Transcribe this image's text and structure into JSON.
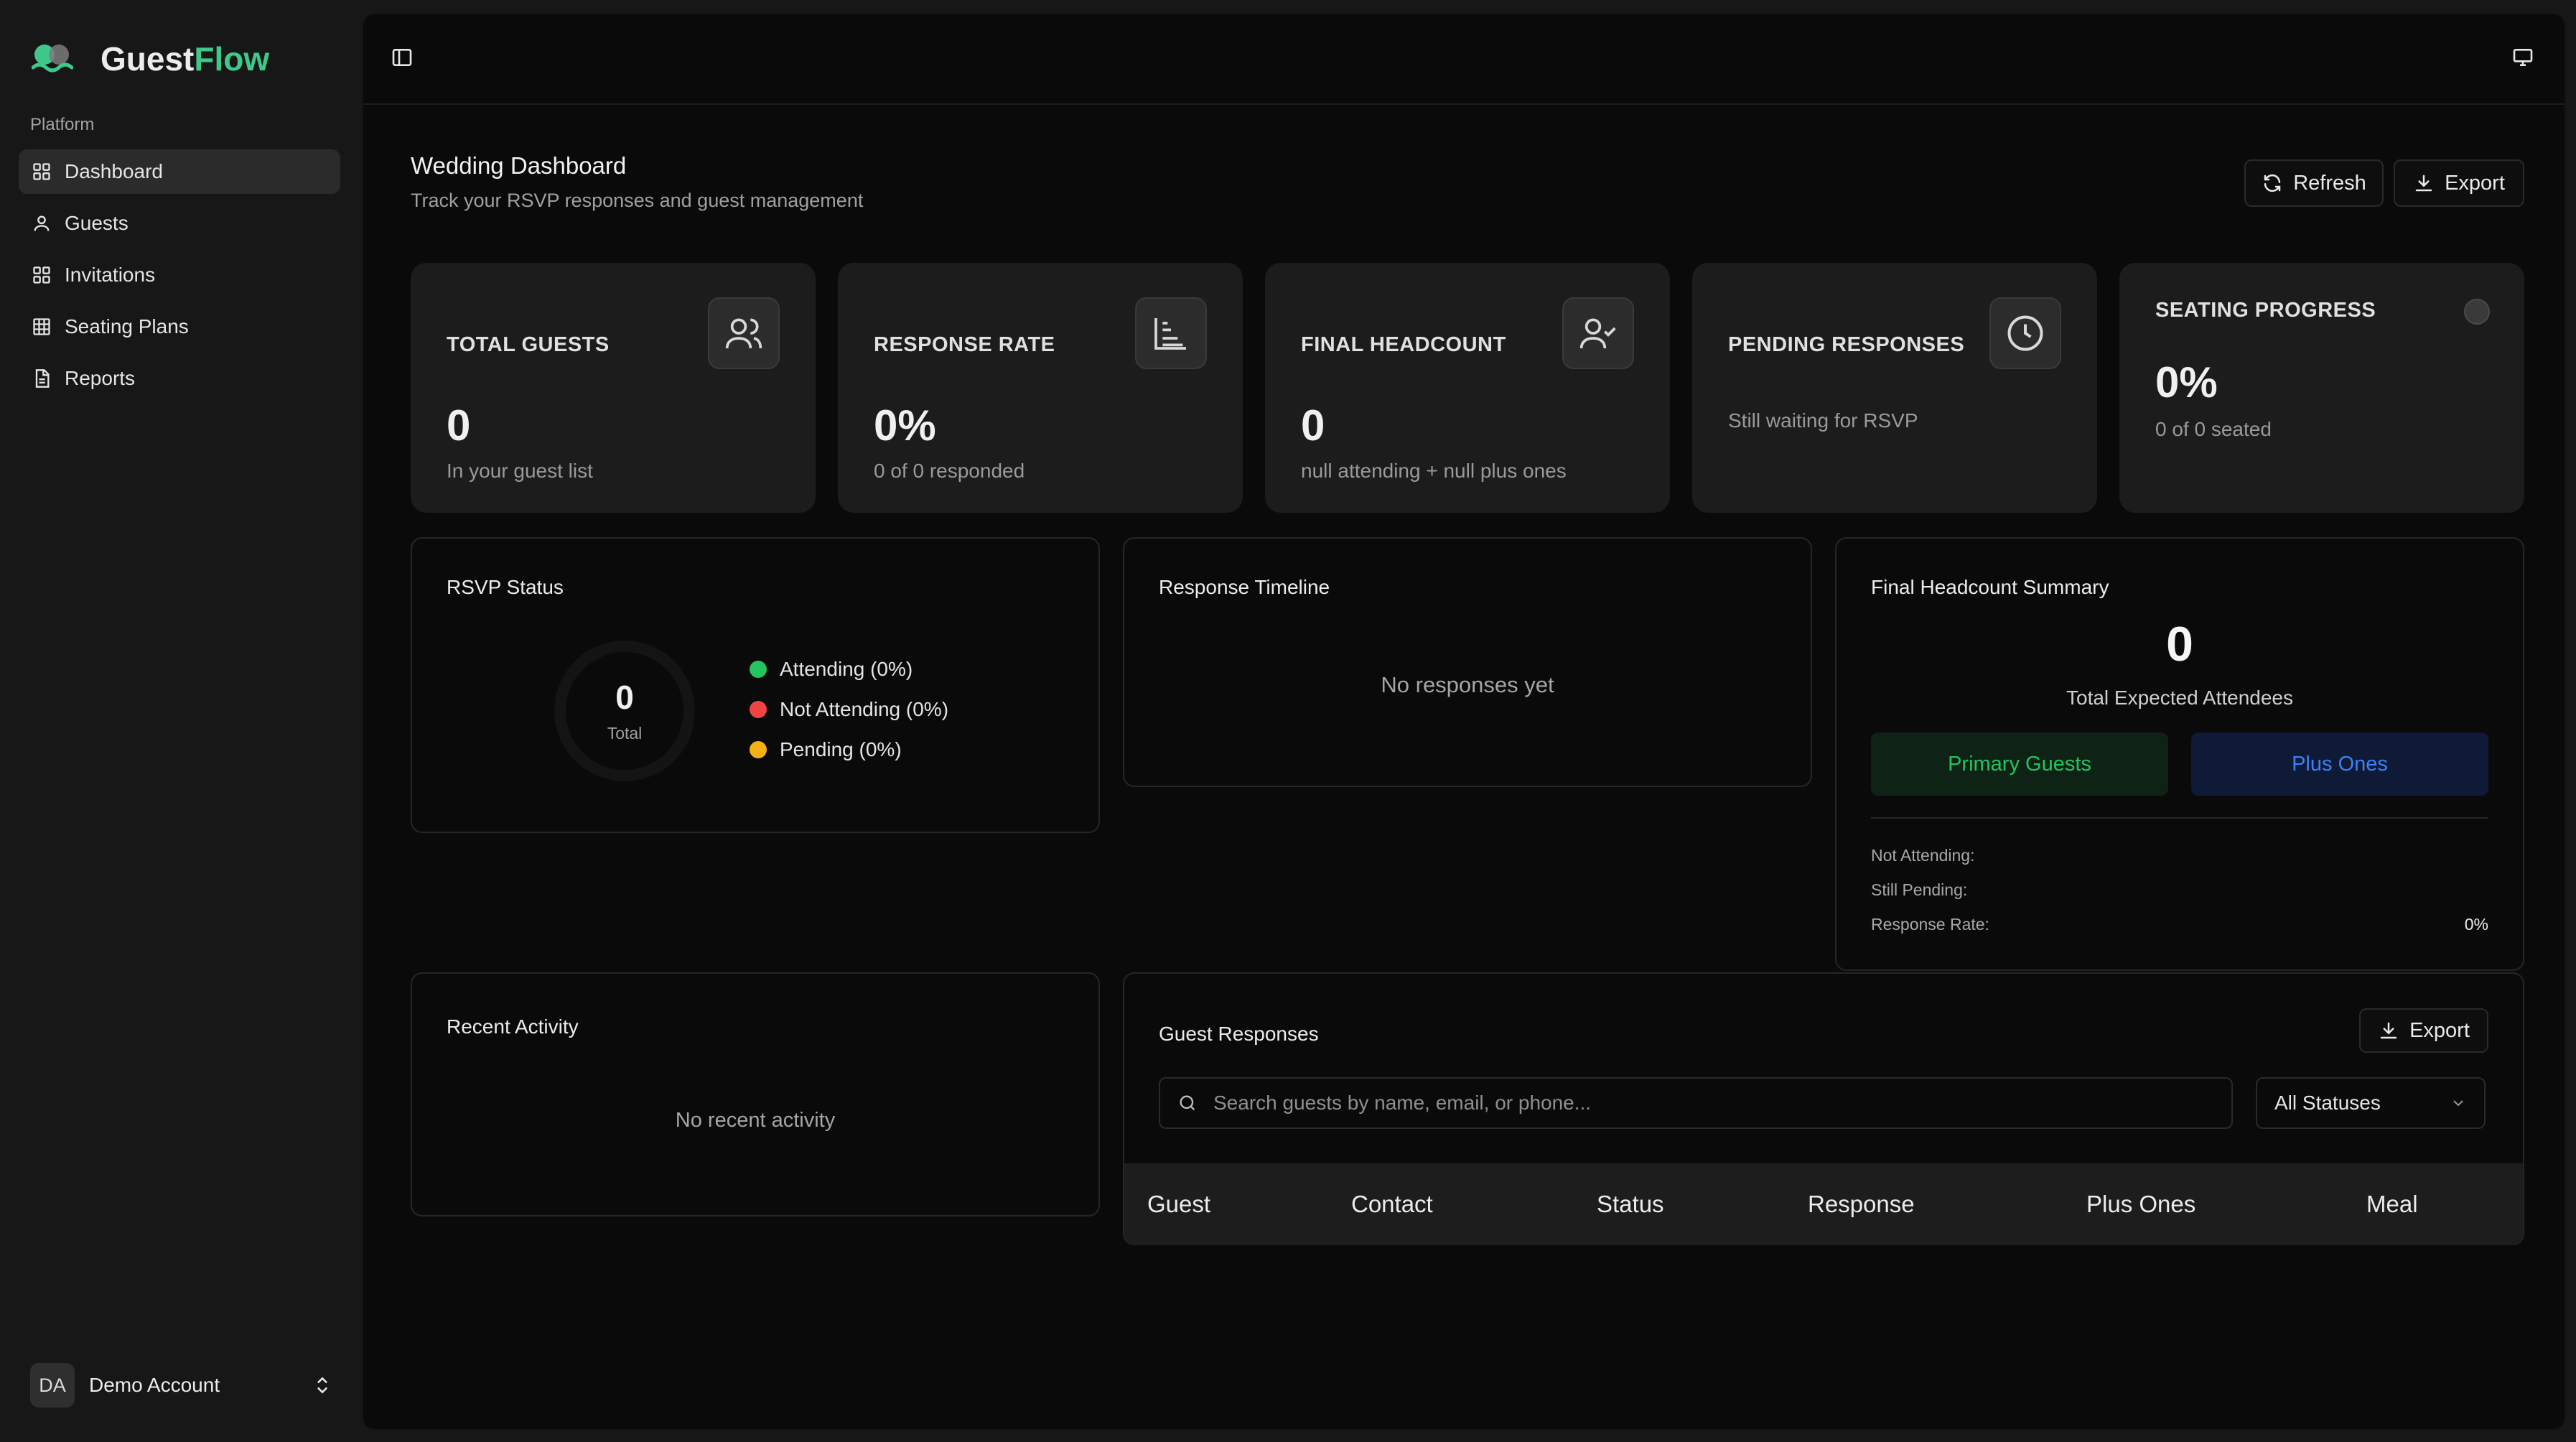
{
  "app": {
    "brand_prefix": "Guest",
    "brand_accent": "Flow",
    "accent_color": "#3ec98b"
  },
  "sidebar": {
    "section_label": "Platform",
    "items": [
      {
        "label": "Dashboard",
        "icon": "grid-icon",
        "active": true
      },
      {
        "label": "Guests",
        "icon": "user-icon"
      },
      {
        "label": "Invitations",
        "icon": "grid-icon"
      },
      {
        "label": "Seating Plans",
        "icon": "table-icon"
      },
      {
        "label": "Reports",
        "icon": "document-icon"
      }
    ],
    "account": {
      "initials": "DA",
      "name": "Demo Account"
    }
  },
  "header": {
    "title": "Wedding Dashboard",
    "subtitle": "Track your RSVP responses and guest management",
    "refresh_label": "Refresh",
    "export_label": "Export"
  },
  "stats": [
    {
      "label": "TOTAL GUESTS",
      "value": "0",
      "sub": "In your guest list",
      "icon": "users-icon"
    },
    {
      "label": "RESPONSE RATE",
      "value": "0%",
      "sub": "0 of 0 responded",
      "icon": "chart-icon"
    },
    {
      "label": "FINAL HEADCOUNT",
      "value": "0",
      "sub": "null attending + null plus ones",
      "icon": "user-check-icon"
    },
    {
      "label": "PENDING RESPONSES",
      "value": "",
      "sub": "Still waiting for RSVP",
      "icon": "clock-icon"
    },
    {
      "label": "SEATING PROGRESS",
      "value": "0%",
      "sub": "0 of 0 seated",
      "icon": "status-dot-icon"
    }
  ],
  "rsvp": {
    "title": "RSVP Status",
    "total_value": "0",
    "total_label": "Total",
    "legend": [
      {
        "label": "Attending (0%)",
        "color": "#22c55e"
      },
      {
        "label": "Not Attending (0%)",
        "color": "#ef4444"
      },
      {
        "label": "Pending (0%)",
        "color": "#f5b014"
      }
    ]
  },
  "timeline": {
    "title": "Response Timeline",
    "empty": "No responses yet"
  },
  "headcount": {
    "title": "Final Headcount Summary",
    "total": "0",
    "total_label": "Total Expected Attendees",
    "primary_label": "Primary Guests",
    "plus_label": "Plus Ones",
    "not_attending_label": "Not Attending:",
    "still_pending_label": "Still Pending:",
    "response_rate_label": "Response Rate:",
    "response_rate_value": "0%"
  },
  "activity": {
    "title": "Recent Activity",
    "empty": "No recent activity"
  },
  "responses": {
    "title": "Guest Responses",
    "export_label": "Export",
    "search_placeholder": "Search guests by name, email, or phone...",
    "filter_value": "All Statuses",
    "columns": [
      "Guest",
      "Contact",
      "Status",
      "Response",
      "Plus Ones",
      "Meal"
    ]
  }
}
